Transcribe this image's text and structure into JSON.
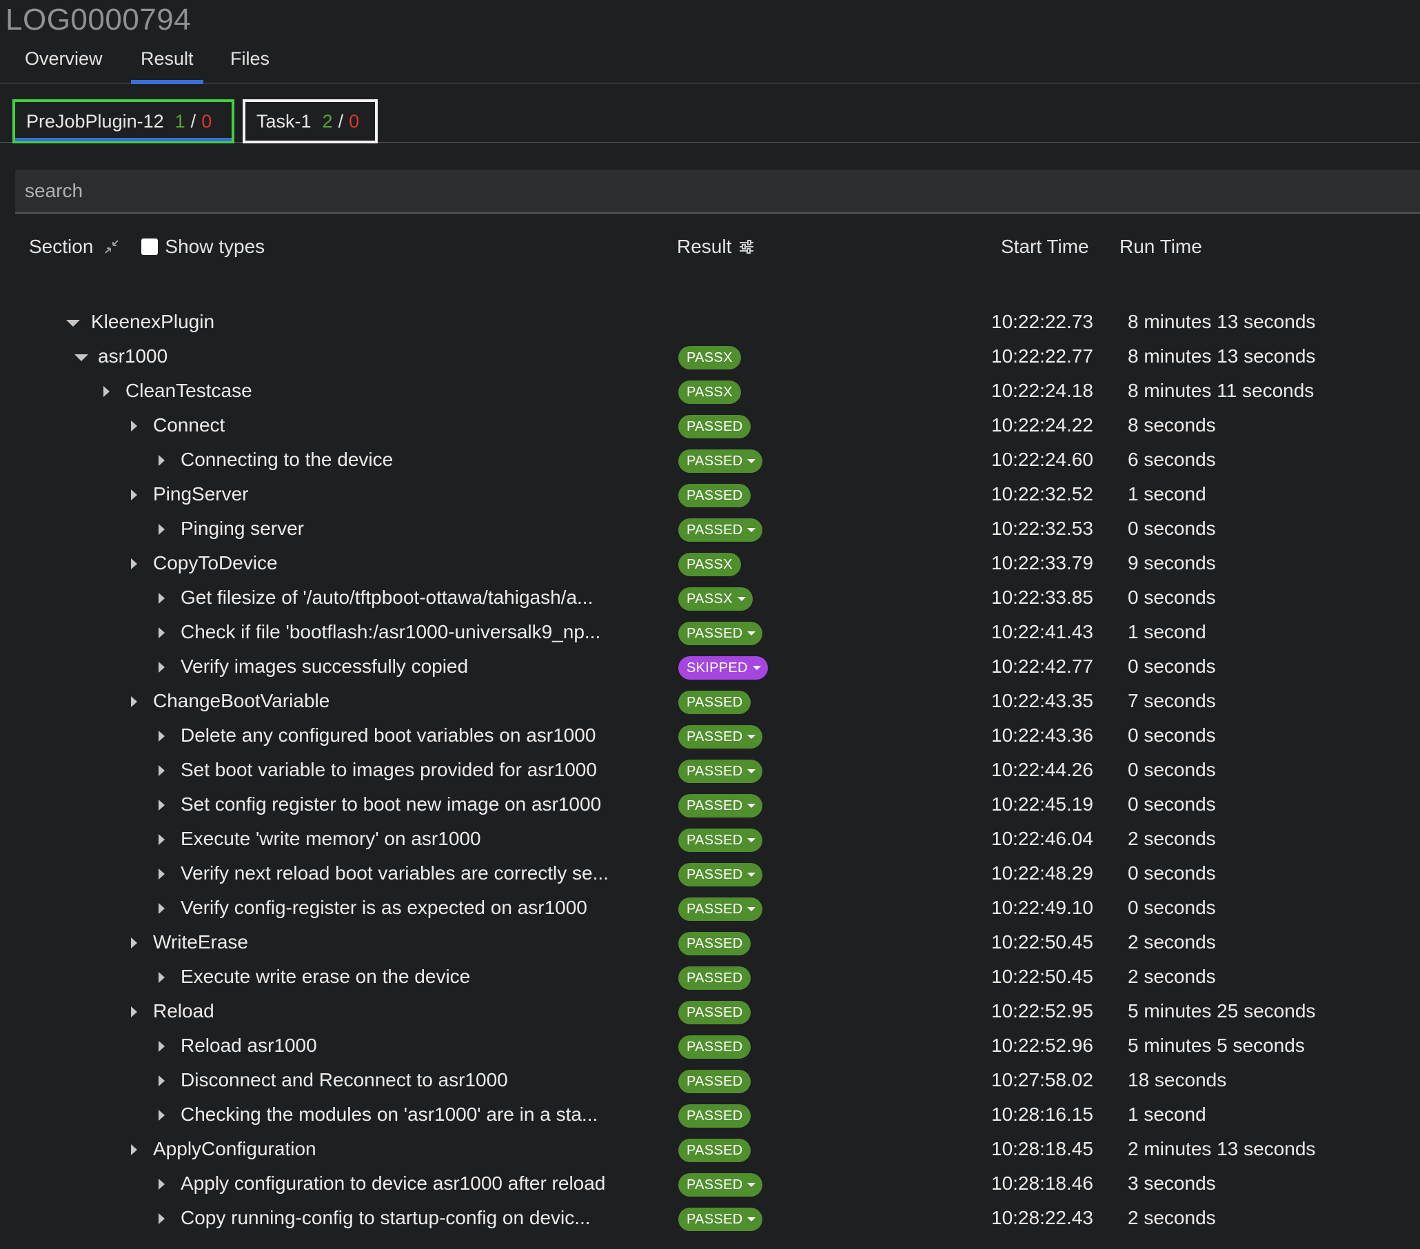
{
  "log_id": "LOG0000794",
  "tabs": [
    {
      "label": "Overview",
      "active": false
    },
    {
      "label": "Result",
      "active": true
    },
    {
      "label": "Files",
      "active": false
    }
  ],
  "jobs": [
    {
      "name": "PreJobPlugin-12",
      "passed": "1",
      "sep": "/",
      "failed": "0",
      "selected": true
    },
    {
      "name": "Task-1",
      "passed": "2",
      "sep": "/",
      "failed": "0",
      "selected": false
    }
  ],
  "search": {
    "placeholder": "search",
    "value": ""
  },
  "columns": {
    "section": "Section",
    "show_types": "Show types",
    "result": "Result",
    "start_time": "Start Time",
    "run_time": "Run Time"
  },
  "colors": {
    "pass": "#4f8f2d",
    "skipped": "#a646e0",
    "selected_outline": "#3fd13f",
    "tab_underline": "#3a6fd6"
  },
  "rows": [
    {
      "name": "KleenexPlugin",
      "level": 0,
      "expanded": true,
      "result": "",
      "dropdown": false,
      "start": "10:22:22.73",
      "run": "8 minutes 13 seconds"
    },
    {
      "name": "asr1000",
      "level": 1,
      "expanded": true,
      "result": "PASSX",
      "dropdown": false,
      "start": "10:22:22.77",
      "run": "8 minutes 13 seconds"
    },
    {
      "name": "CleanTestcase",
      "level": 2,
      "expanded": false,
      "result": "PASSX",
      "dropdown": false,
      "start": "10:22:24.18",
      "run": "8 minutes 11 seconds"
    },
    {
      "name": "Connect",
      "level": 3,
      "expanded": false,
      "result": "PASSED",
      "dropdown": false,
      "start": "10:22:24.22",
      "run": "8 seconds"
    },
    {
      "name": "Connecting to the device",
      "level": 4,
      "expanded": false,
      "result": "PASSED",
      "dropdown": true,
      "start": "10:22:24.60",
      "run": "6 seconds"
    },
    {
      "name": "PingServer",
      "level": 3,
      "expanded": false,
      "result": "PASSED",
      "dropdown": false,
      "start": "10:22:32.52",
      "run": "1 second"
    },
    {
      "name": "Pinging server",
      "level": 4,
      "expanded": false,
      "result": "PASSED",
      "dropdown": true,
      "start": "10:22:32.53",
      "run": "0 seconds"
    },
    {
      "name": "CopyToDevice",
      "level": 3,
      "expanded": false,
      "result": "PASSX",
      "dropdown": false,
      "start": "10:22:33.79",
      "run": "9 seconds"
    },
    {
      "name": "Get filesize of '/auto/tftpboot-ottawa/tahigash/a...",
      "level": 4,
      "expanded": false,
      "result": "PASSX",
      "dropdown": true,
      "start": "10:22:33.85",
      "run": "0 seconds"
    },
    {
      "name": "Check if file 'bootflash:/asr1000-universalk9_np...",
      "level": 4,
      "expanded": false,
      "result": "PASSED",
      "dropdown": true,
      "start": "10:22:41.43",
      "run": "1 second"
    },
    {
      "name": "Verify images successfully copied",
      "level": 4,
      "expanded": false,
      "result": "SKIPPED",
      "dropdown": true,
      "start": "10:22:42.77",
      "run": "0 seconds"
    },
    {
      "name": "ChangeBootVariable",
      "level": 3,
      "expanded": false,
      "result": "PASSED",
      "dropdown": false,
      "start": "10:22:43.35",
      "run": "7 seconds"
    },
    {
      "name": "Delete any configured boot variables on asr1000",
      "level": 4,
      "expanded": false,
      "result": "PASSED",
      "dropdown": true,
      "start": "10:22:43.36",
      "run": "0 seconds"
    },
    {
      "name": "Set boot variable to images provided for asr1000",
      "level": 4,
      "expanded": false,
      "result": "PASSED",
      "dropdown": true,
      "start": "10:22:44.26",
      "run": "0 seconds"
    },
    {
      "name": "Set config register to boot new image on asr1000",
      "level": 4,
      "expanded": false,
      "result": "PASSED",
      "dropdown": true,
      "start": "10:22:45.19",
      "run": "0 seconds"
    },
    {
      "name": "Execute 'write memory' on asr1000",
      "level": 4,
      "expanded": false,
      "result": "PASSED",
      "dropdown": true,
      "start": "10:22:46.04",
      "run": "2 seconds"
    },
    {
      "name": "Verify next reload boot variables are correctly se...",
      "level": 4,
      "expanded": false,
      "result": "PASSED",
      "dropdown": true,
      "start": "10:22:48.29",
      "run": "0 seconds"
    },
    {
      "name": "Verify config-register is as expected on asr1000",
      "level": 4,
      "expanded": false,
      "result": "PASSED",
      "dropdown": true,
      "start": "10:22:49.10",
      "run": "0 seconds"
    },
    {
      "name": "WriteErase",
      "level": 3,
      "expanded": false,
      "result": "PASSED",
      "dropdown": false,
      "start": "10:22:50.45",
      "run": "2 seconds"
    },
    {
      "name": "Execute write erase on the device",
      "level": 4,
      "expanded": false,
      "result": "PASSED",
      "dropdown": false,
      "start": "10:22:50.45",
      "run": "2 seconds"
    },
    {
      "name": "Reload",
      "level": 3,
      "expanded": false,
      "result": "PASSED",
      "dropdown": false,
      "start": "10:22:52.95",
      "run": "5 minutes 25 seconds"
    },
    {
      "name": "Reload asr1000",
      "level": 4,
      "expanded": false,
      "result": "PASSED",
      "dropdown": false,
      "start": "10:22:52.96",
      "run": "5 minutes 5 seconds"
    },
    {
      "name": "Disconnect and Reconnect to asr1000",
      "level": 4,
      "expanded": false,
      "result": "PASSED",
      "dropdown": false,
      "start": "10:27:58.02",
      "run": "18 seconds"
    },
    {
      "name": "Checking the modules on 'asr1000' are in a sta...",
      "level": 4,
      "expanded": false,
      "result": "PASSED",
      "dropdown": false,
      "start": "10:28:16.15",
      "run": "1 second"
    },
    {
      "name": "ApplyConfiguration",
      "level": 3,
      "expanded": false,
      "result": "PASSED",
      "dropdown": false,
      "start": "10:28:18.45",
      "run": "2 minutes 13 seconds"
    },
    {
      "name": "Apply configuration to device asr1000 after reload",
      "level": 4,
      "expanded": false,
      "result": "PASSED",
      "dropdown": true,
      "start": "10:28:18.46",
      "run": "3 seconds"
    },
    {
      "name": "Copy running-config to startup-config on devic...",
      "level": 4,
      "expanded": false,
      "result": "PASSED",
      "dropdown": true,
      "start": "10:28:22.43",
      "run": "2 seconds"
    }
  ]
}
